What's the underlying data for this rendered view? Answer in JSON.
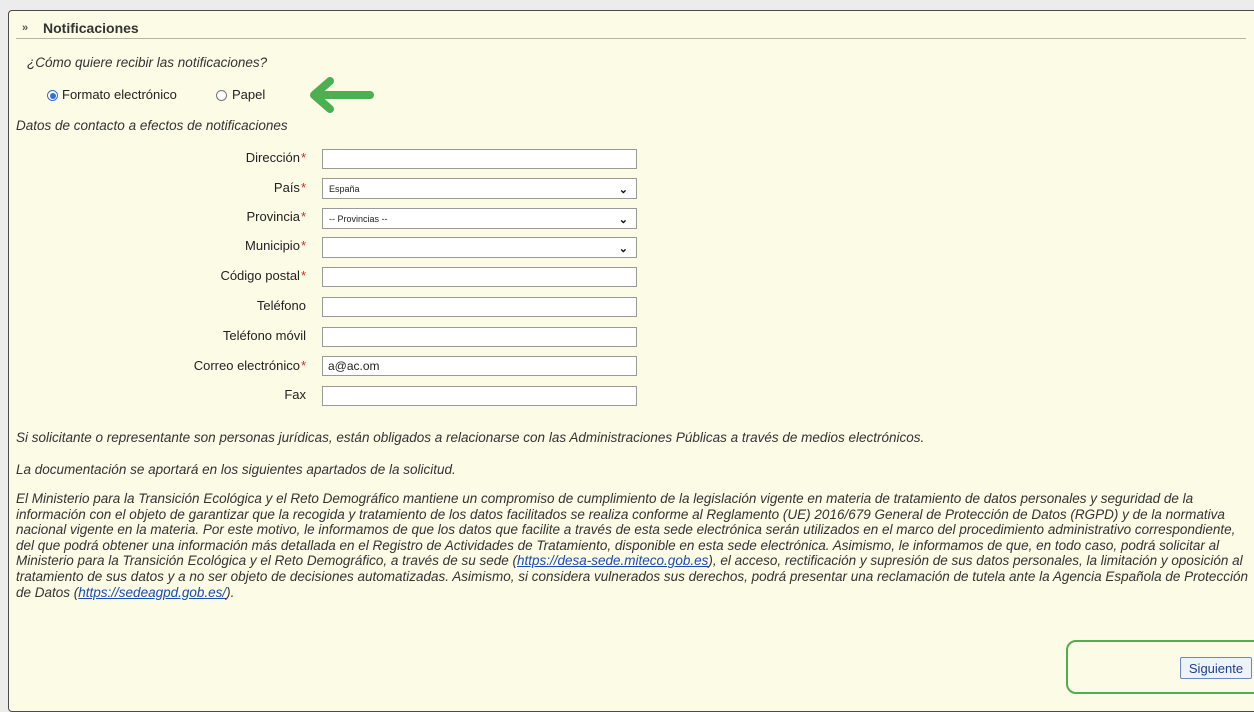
{
  "section": {
    "title": "Notificaciones"
  },
  "question": "¿Cómo quiere recibir las notificaciones?",
  "delivery": {
    "options": [
      {
        "label": "Formato electrónico",
        "checked": true
      },
      {
        "label": "Papel",
        "checked": false
      }
    ]
  },
  "contact_heading": "Datos de contacto a efectos de notificaciones",
  "form": {
    "direccion": {
      "label": "Dirección",
      "required": "*",
      "value": ""
    },
    "pais": {
      "label": "País",
      "required": "*",
      "value": "España"
    },
    "provincia": {
      "label": "Provincia",
      "required": "*",
      "value": "-- Provincias --"
    },
    "municipio": {
      "label": "Municipio",
      "required": "*",
      "value": ""
    },
    "codigo_postal": {
      "label": "Código postal",
      "required": "*",
      "value": ""
    },
    "telefono": {
      "label": "Teléfono",
      "value": ""
    },
    "telefono_movil": {
      "label": "Teléfono móvil",
      "value": ""
    },
    "correo": {
      "label": "Correo electrónico",
      "required": "*",
      "value": "a@ac.om"
    },
    "fax": {
      "label": "Fax",
      "value": ""
    }
  },
  "notes": {
    "legal_entities": "Si solicitante o representante son personas jurídicas, están obligados a relacionarse con las Administraciones Públicas a través de medios electrónicos.",
    "documentation": "La documentación se aportará en los siguientes apartados de la solicitud.",
    "privacy_part1": "El Ministerio para la Transición Ecológica y el Reto Demográfico mantiene un compromiso de cumplimiento de la legislación vigente en materia de tratamiento de datos personales y seguridad de la información con el objeto de garantizar que la recogida y tratamiento de los datos facilitados se realiza conforme al Reglamento (UE) 2016/679 General de Protección de Datos (RGPD) y de la normativa nacional vigente en la materia. Por este motivo, le informamos de que los datos que facilite a través de esta sede electrónica serán utilizados en el marco del procedimiento administrativo correspondiente, del que podrá obtener una información más detallada en el Registro de Actividades de Tratamiento, disponible en esta sede electrónica. Asimismo, le informamos de que, en todo caso, podrá solicitar al Ministerio para la Transición Ecológica y el Reto Demográfico, a través de su sede (",
    "privacy_link1": "https://desa-sede.miteco.gob.es",
    "privacy_part2": "), el acceso, rectificación y supresión de sus datos personales, la limitación y oposición al tratamiento de sus datos y a no ser objeto de decisiones automatizadas. Asimismo, si considera vulnerados sus derechos, podrá presentar una reclamación de tutela ante la Agencia Española de Protección de Datos (",
    "privacy_link2": "https://sedeagpd.gob.es/",
    "privacy_part3": ")."
  },
  "actions": {
    "next_label": "Siguiente"
  },
  "colors": {
    "panel_bg": "#fbfbe6",
    "annotation_green": "#4caf50",
    "required_red": "#d12b2b",
    "radio_blue": "#2f6fd6"
  }
}
